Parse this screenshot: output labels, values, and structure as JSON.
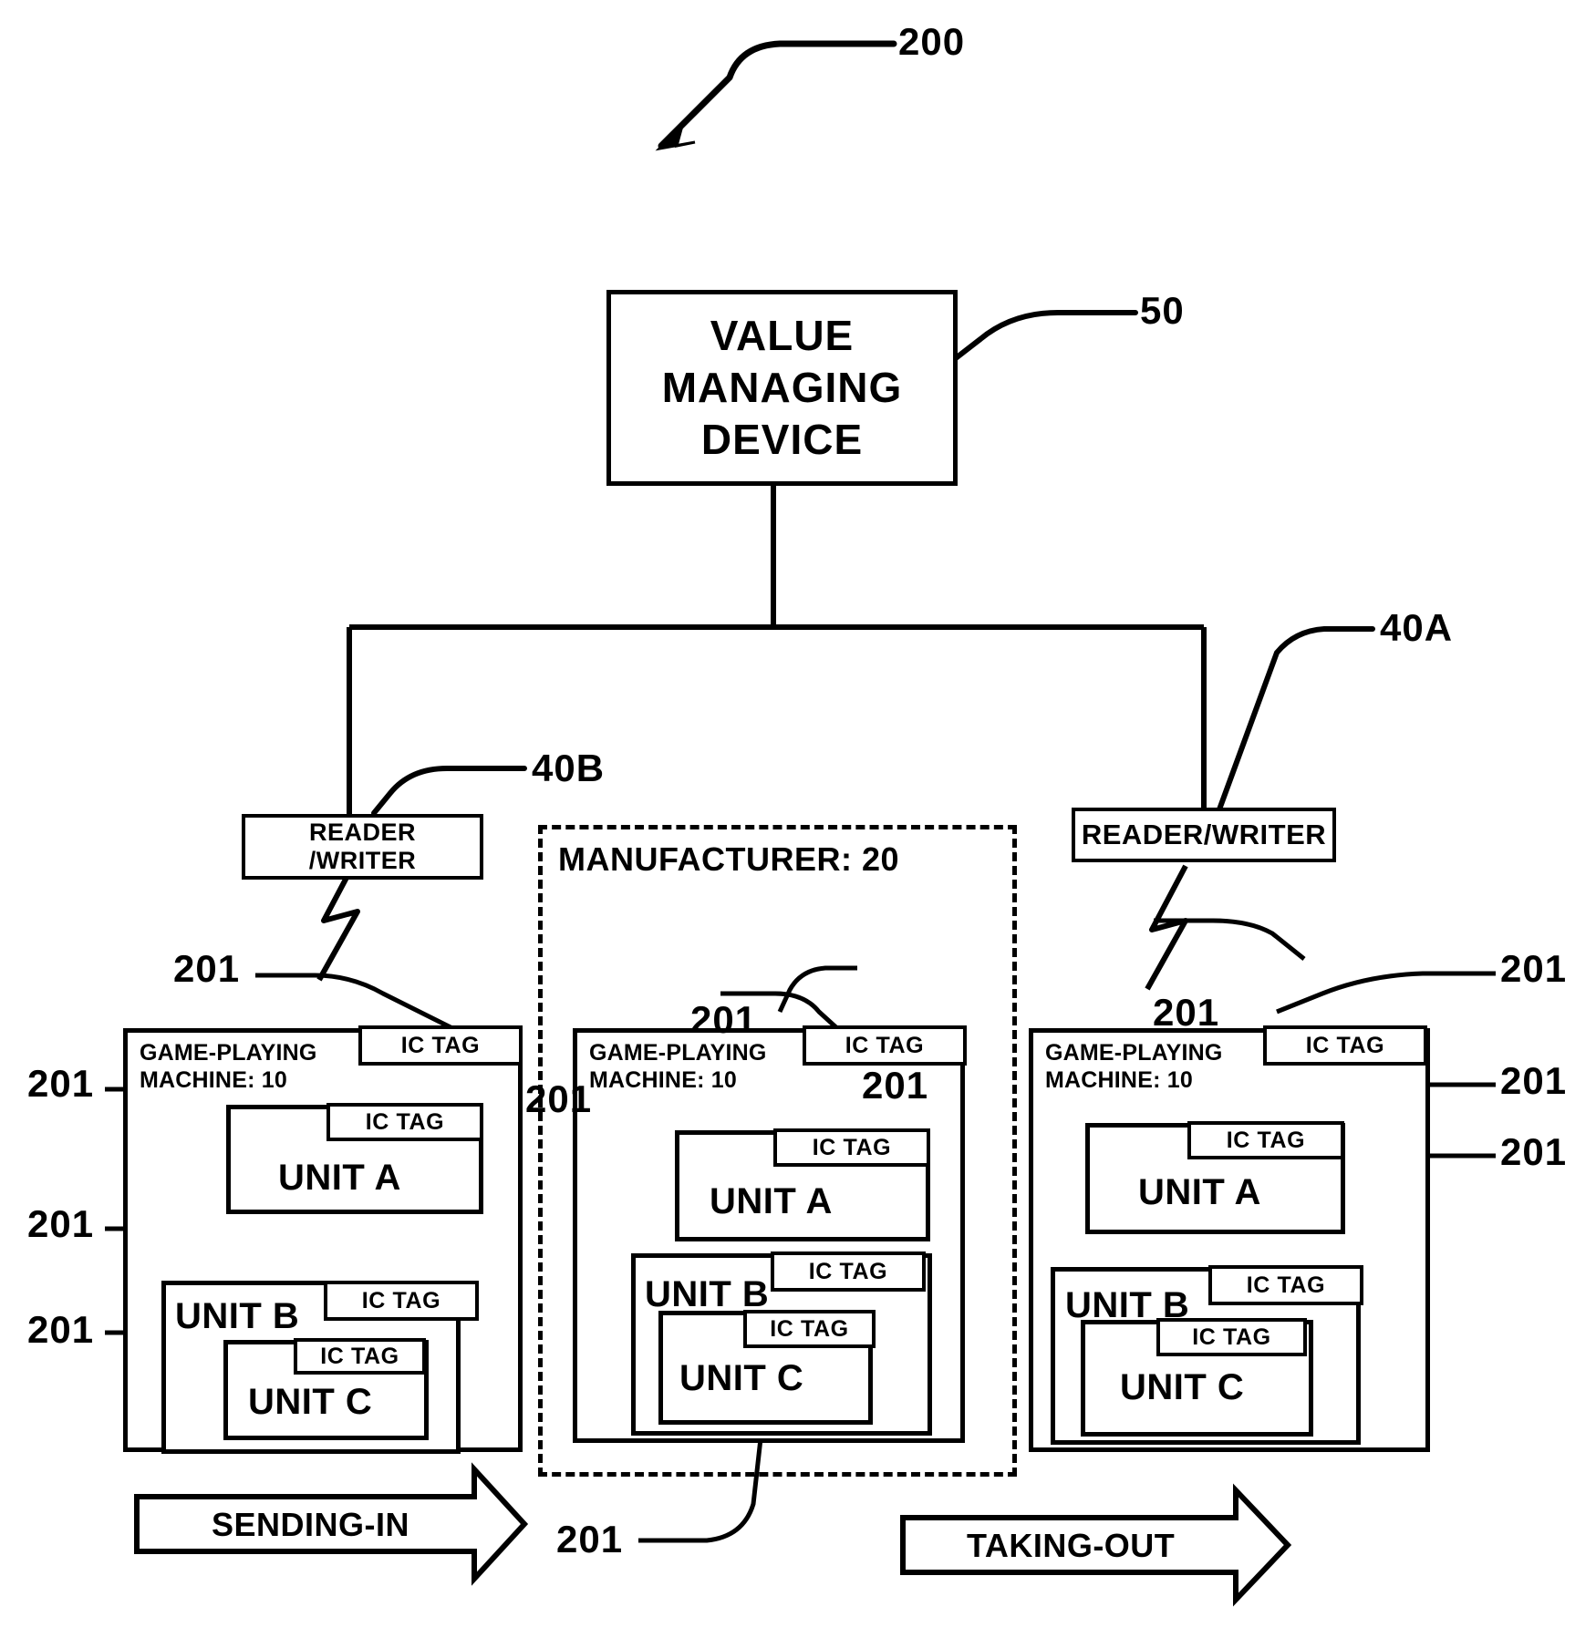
{
  "figure": {
    "system_ref": "200",
    "value_managing_device": {
      "label": "VALUE\nMANAGING\nDEVICE",
      "ref": "50"
    },
    "readers": [
      {
        "name": "reader-writer-left",
        "label": "READER\n/WRITER",
        "ref": "40B"
      },
      {
        "name": "reader-writer-right",
        "label": "READER/WRITER",
        "ref": "40A"
      }
    ],
    "manufacturer_region": {
      "label": "MANUFACTURER: 20"
    },
    "machines": [
      {
        "name": "game-playing-machine-left",
        "label": "GAME-PLAYING\nMACHINE: 10",
        "tag": "IC TAG",
        "units": [
          {
            "label": "UNIT A",
            "tag": "IC TAG"
          },
          {
            "label": "UNIT B",
            "tag": "IC TAG"
          },
          {
            "label": "UNIT C",
            "tag": "IC TAG"
          }
        ]
      },
      {
        "name": "game-playing-machine-center",
        "label": "GAME-PLAYING\nMACHINE: 10",
        "tag": "IC TAG",
        "units": [
          {
            "label": "UNIT A",
            "tag": "IC TAG"
          },
          {
            "label": "UNIT B",
            "tag": "IC TAG"
          },
          {
            "label": "UNIT C",
            "tag": "IC TAG"
          }
        ]
      },
      {
        "name": "game-playing-machine-right",
        "label": "GAME-PLAYING\nMACHINE: 10",
        "tag": "IC TAG",
        "units": [
          {
            "label": "UNIT A",
            "tag": "IC TAG"
          },
          {
            "label": "UNIT B",
            "tag": "IC TAG"
          },
          {
            "label": "UNIT C",
            "tag": "IC TAG"
          }
        ]
      }
    ],
    "tag_refs": {
      "r1": "201",
      "r2": "201",
      "r3": "201",
      "r4": "201",
      "r5": "201",
      "r6": "201",
      "r7": "201",
      "r8": "201",
      "r9": "201",
      "r10": "201",
      "r11": "201"
    },
    "flow_arrows": [
      {
        "name": "sending-in-arrow",
        "label": "SENDING-IN"
      },
      {
        "name": "taking-out-arrow",
        "label": "TAKING-OUT"
      }
    ]
  }
}
